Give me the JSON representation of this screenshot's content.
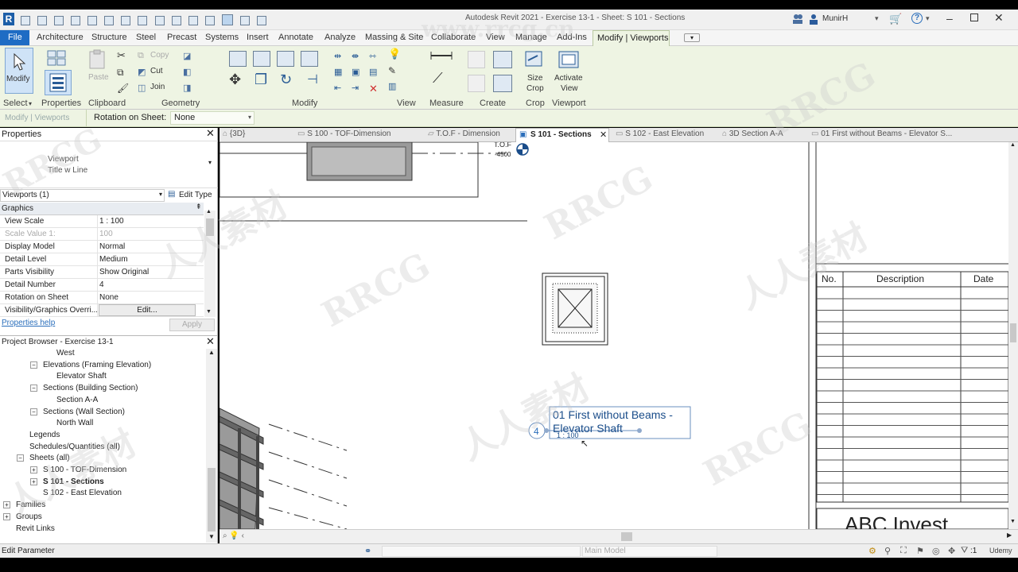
{
  "app": {
    "title": "Autodesk Revit 2021 - Exercise 13-1 - Sheet: S 101 - Sections",
    "user": "MunirH"
  },
  "ribbon": {
    "tabs": [
      "File",
      "Architecture",
      "Structure",
      "Steel",
      "Precast",
      "Systems",
      "Insert",
      "Annotate",
      "Analyze",
      "Massing & Site",
      "Collaborate",
      "View",
      "Manage",
      "Add-Ins",
      "Modify | Viewports"
    ],
    "active_tab": "Modify | Viewports",
    "panels": {
      "select": "Select",
      "properties": "Properties",
      "clipboard": "Clipboard",
      "geometry": "Geometry",
      "modify": "Modify",
      "view": "View",
      "measure": "Measure",
      "create": "Create",
      "crop": "Crop",
      "viewport": "Viewport"
    },
    "buttons": {
      "modify": "Modify",
      "paste": "Paste",
      "copy": "Copy",
      "cut": "Cut",
      "join": "Join",
      "size_crop_1": "Size",
      "size_crop_2": "Crop",
      "activate_view_1": "Activate",
      "activate_view_2": "View"
    }
  },
  "context_bar": {
    "label": "Modify | Viewports",
    "rotation_label": "Rotation on Sheet:",
    "rotation_value": "None"
  },
  "properties": {
    "header": "Properties",
    "type_line1": "Viewport",
    "type_line2": "Title w Line",
    "selector": "Viewports (1)",
    "edit_type": "Edit Type",
    "group": "Graphics",
    "rows": [
      {
        "k": "View Scale",
        "v": "1 : 100"
      },
      {
        "k": "Scale Value    1:",
        "v": "100"
      },
      {
        "k": "Display Model",
        "v": "Normal"
      },
      {
        "k": "Detail Level",
        "v": "Medium"
      },
      {
        "k": "Parts Visibility",
        "v": "Show Original"
      },
      {
        "k": "Detail Number",
        "v": "4"
      },
      {
        "k": "Rotation on Sheet",
        "v": "None"
      },
      {
        "k": "Visibility/Graphics Overri...",
        "v": "Edit..."
      }
    ],
    "help": "Properties help",
    "apply": "Apply"
  },
  "browser": {
    "header": "Project Browser - Exercise 13-1",
    "items": [
      {
        "label": "West",
        "indent": 3,
        "exp": ""
      },
      {
        "label": "Elevations (Framing Elevation)",
        "indent": 2,
        "exp": "−"
      },
      {
        "label": "Elevator Shaft",
        "indent": 3,
        "exp": ""
      },
      {
        "label": "Sections (Building Section)",
        "indent": 2,
        "exp": "−"
      },
      {
        "label": "Section A-A",
        "indent": 3,
        "exp": ""
      },
      {
        "label": "Sections (Wall Section)",
        "indent": 2,
        "exp": "−"
      },
      {
        "label": "North Wall",
        "indent": 3,
        "exp": ""
      },
      {
        "label": "Legends",
        "indent": 1,
        "exp": ""
      },
      {
        "label": "Schedules/Quantities (all)",
        "indent": 1,
        "exp": ""
      },
      {
        "label": "Sheets (all)",
        "indent": 1,
        "exp": "−"
      },
      {
        "label": "S 100 - TOF-Dimension",
        "indent": 2,
        "exp": "+"
      },
      {
        "label": "S 101 - Sections",
        "indent": 2,
        "exp": "+",
        "bold": true
      },
      {
        "label": "S 102 - East Elevation",
        "indent": 2,
        "exp": ""
      },
      {
        "label": "Families",
        "indent": 0,
        "exp": "+"
      },
      {
        "label": "Groups",
        "indent": 0,
        "exp": "+"
      },
      {
        "label": "Revit Links",
        "indent": 0,
        "exp": ""
      }
    ]
  },
  "doc_tabs": [
    {
      "label": "{3D}",
      "active": false
    },
    {
      "label": "S 100 - TOF-Dimension",
      "active": false
    },
    {
      "label": "T.O.F - Dimension",
      "active": false
    },
    {
      "label": "S 101 - Sections",
      "active": true
    },
    {
      "label": "S 102 - East Elevation",
      "active": false
    },
    {
      "label": "3D Section A-A",
      "active": false
    },
    {
      "label": "01 First without Beams - Elevator S...",
      "active": false
    }
  ],
  "canvas": {
    "level_tag": "T.O.F",
    "level_value": "-4500",
    "viewport_number": "4",
    "viewport_title_1": "01 First without Beams -",
    "viewport_title_2": "Elevator Shaft",
    "viewport_scale": "1 : 100",
    "revision_headers": [
      "No.",
      "Description",
      "Date"
    ],
    "company": "ABC Invest"
  },
  "status": {
    "left": "Edit Parameter",
    "model": "Main Model",
    "filter_count": ":1",
    "udemy": "Udemy"
  },
  "watermarks": [
    "RRCG",
    "人人素材",
    "RRCG",
    "人人素材",
    "RRCG",
    "人人素材",
    "RRCG",
    "人人素材",
    "RRCG",
    "www.rrcg.cn"
  ],
  "colors": {
    "file_tab": "#1e6cc4",
    "context_bg": "#eef4e3",
    "accent": "#2a6ebb"
  }
}
